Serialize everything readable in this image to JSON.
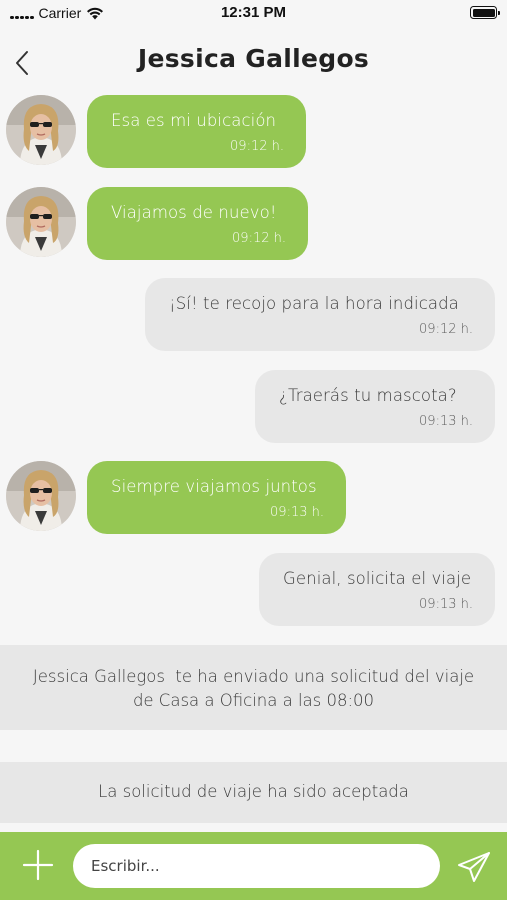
{
  "status_bar": {
    "carrier": "Carrier",
    "time": "12:31 PM"
  },
  "header": {
    "title": "Jessica Gallegos"
  },
  "messages": [
    {
      "direction": "in",
      "text": "Esa es mi ubicación",
      "time": "09:12 h."
    },
    {
      "direction": "in",
      "text": "Viajamos de nuevo!",
      "time": "09:12 h."
    },
    {
      "direction": "out",
      "text": "¡Sí! te recojo para la hora indicada",
      "time": "09:12 h."
    },
    {
      "direction": "out",
      "text": "¿Traerás tu mascota?",
      "time": "09:13 h."
    },
    {
      "direction": "in",
      "text": "Siempre viajamos juntos",
      "time": "09:13 h."
    },
    {
      "direction": "out",
      "text": "Genial, solicita el viaje",
      "time": "09:13 h."
    }
  ],
  "notices": [
    {
      "line1": "Jessica Gallegos  te ha enviado una solicitud del viaje",
      "line2": "de Casa a Oficina a las 08:00"
    },
    {
      "line1": "La solicitud de viaje ha sido aceptada"
    }
  ],
  "composer": {
    "placeholder": "Escribir..."
  },
  "icons": {
    "back": "chevron-left-icon",
    "wifi": "wifi-icon",
    "battery": "battery-icon",
    "add": "plus-icon",
    "send": "send-icon"
  },
  "colors": {
    "accent_green": "#95c753",
    "outgoing_bubble": "#e7e7e7",
    "background": "#f6f6f6"
  }
}
